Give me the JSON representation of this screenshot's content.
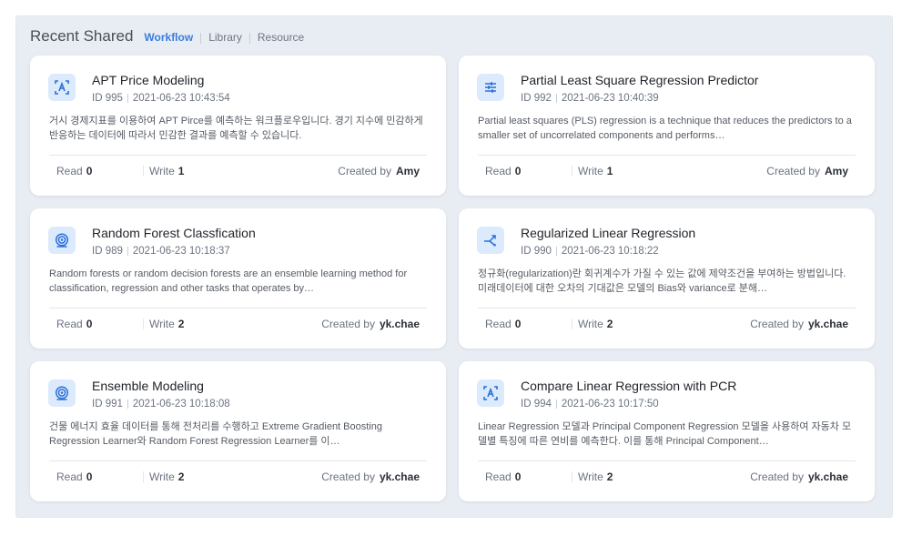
{
  "header": {
    "title": "Recent Shared",
    "tabs": [
      {
        "label": "Workflow",
        "active": true
      },
      {
        "label": "Library",
        "active": false
      },
      {
        "label": "Resource",
        "active": false
      }
    ]
  },
  "labels": {
    "read": "Read",
    "write": "Write",
    "created_by": "Created by"
  },
  "colors": {
    "accent": "#3b7ddd",
    "icon_bg": "#dceafd",
    "icon_fg": "#2a6fd6",
    "panel_bg": "#e8edf3"
  },
  "cards": [
    {
      "icon": "text-ai-icon",
      "title": "APT Price Modeling",
      "id": "ID 995",
      "date": "2021-06-23 10:43:54",
      "description": "거시 경제지표를 이용하여 APT Pirce를 예측하는 워크플로우입니다. 경기 지수에 민감하게 반응하는 데이터에 따라서 민감한 결과를 예측할 수 있습니다.",
      "read": "0",
      "write": "1",
      "author": "Amy"
    },
    {
      "icon": "sliders-icon",
      "title": "Partial Least Square Regression Predictor",
      "id": "ID 992",
      "date": "2021-06-23 10:40:39",
      "description": "Partial least squares (PLS) regression is a technique that reduces the predictors to a smaller set of uncorrelated components and performs…",
      "read": "0",
      "write": "1",
      "author": "Amy"
    },
    {
      "icon": "target-icon",
      "title": "Random Forest Classfication",
      "id": "ID 989",
      "date": "2021-06-23 10:18:37",
      "description": "Random forests or random decision forests are an ensemble learning method for classification, regression and other tasks that operates by…",
      "read": "0",
      "write": "2",
      "author": "yk.chae"
    },
    {
      "icon": "split-arrow-icon",
      "title": "Regularized Linear Regression",
      "id": "ID 990",
      "date": "2021-06-23 10:18:22",
      "description": "정규화(regularization)란 회귀계수가 가질 수 있는 값에 제약조건을 부여하는 방법입니다. 미래데이터에 대한 오차의 기대값은 모델의 Bias와 variance로 분해…",
      "read": "0",
      "write": "2",
      "author": "yk.chae"
    },
    {
      "icon": "target-icon",
      "title": "Ensemble Modeling",
      "id": "ID 991",
      "date": "2021-06-23 10:18:08",
      "description": "건물 에너지 효율 데이터를 통해 전처리를 수행하고 Extreme Gradient Boosting Regression Learner와 Random Forest Regression Learner를 이…",
      "read": "0",
      "write": "2",
      "author": "yk.chae"
    },
    {
      "icon": "text-ai-icon",
      "title": "Compare Linear Regression with PCR",
      "id": "ID 994",
      "date": "2021-06-23 10:17:50",
      "description": "Linear Regression 모델과 Principal Component Regression 모델을 사용하여 자동차 모델별 특징에 따른 연비를 예측한다. 이를 통해 Principal Component…",
      "read": "0",
      "write": "2",
      "author": "yk.chae"
    }
  ]
}
